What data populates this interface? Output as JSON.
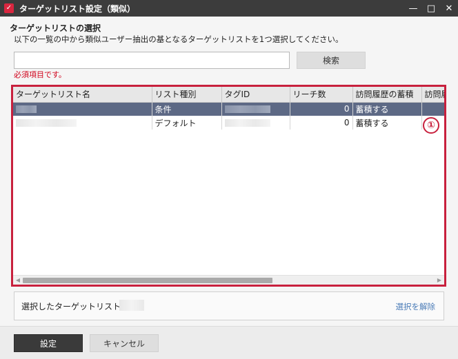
{
  "window": {
    "title": "ターゲットリスト設定（類似）",
    "icon": "checkmark-app-icon",
    "controls": {
      "minimize": "—",
      "maximize": "□",
      "close": "✕"
    }
  },
  "section": {
    "title": "ターゲットリストの選択",
    "instruction": "以下の一覧の中から類似ユーザー抽出の基となるターゲットリストを1つ選択してください。"
  },
  "search": {
    "value": "",
    "placeholder": "",
    "button_label": "検索",
    "required_message": "必須項目です。"
  },
  "grid": {
    "columns": [
      "ターゲットリスト名",
      "リスト種別",
      "タグID",
      "リーチ数",
      "訪問履歴の蓄積",
      "訪問履"
    ],
    "rows": [
      {
        "name": "",
        "type": "条件",
        "tag_id": "",
        "reach": "0",
        "history": "蓄積する",
        "selected": true
      },
      {
        "name": "",
        "type": "デフォルト",
        "tag_id": "",
        "reach": "0",
        "history": "蓄積する",
        "selected": false
      }
    ],
    "badge": "①",
    "accent_color": "#c8203d",
    "selected_row_color": "#5d6985"
  },
  "selection": {
    "label": "選択したターゲットリスト",
    "value": "",
    "clear_link": "選択を解除"
  },
  "footer": {
    "primary_label": "設定",
    "cancel_label": "キャンセル"
  }
}
